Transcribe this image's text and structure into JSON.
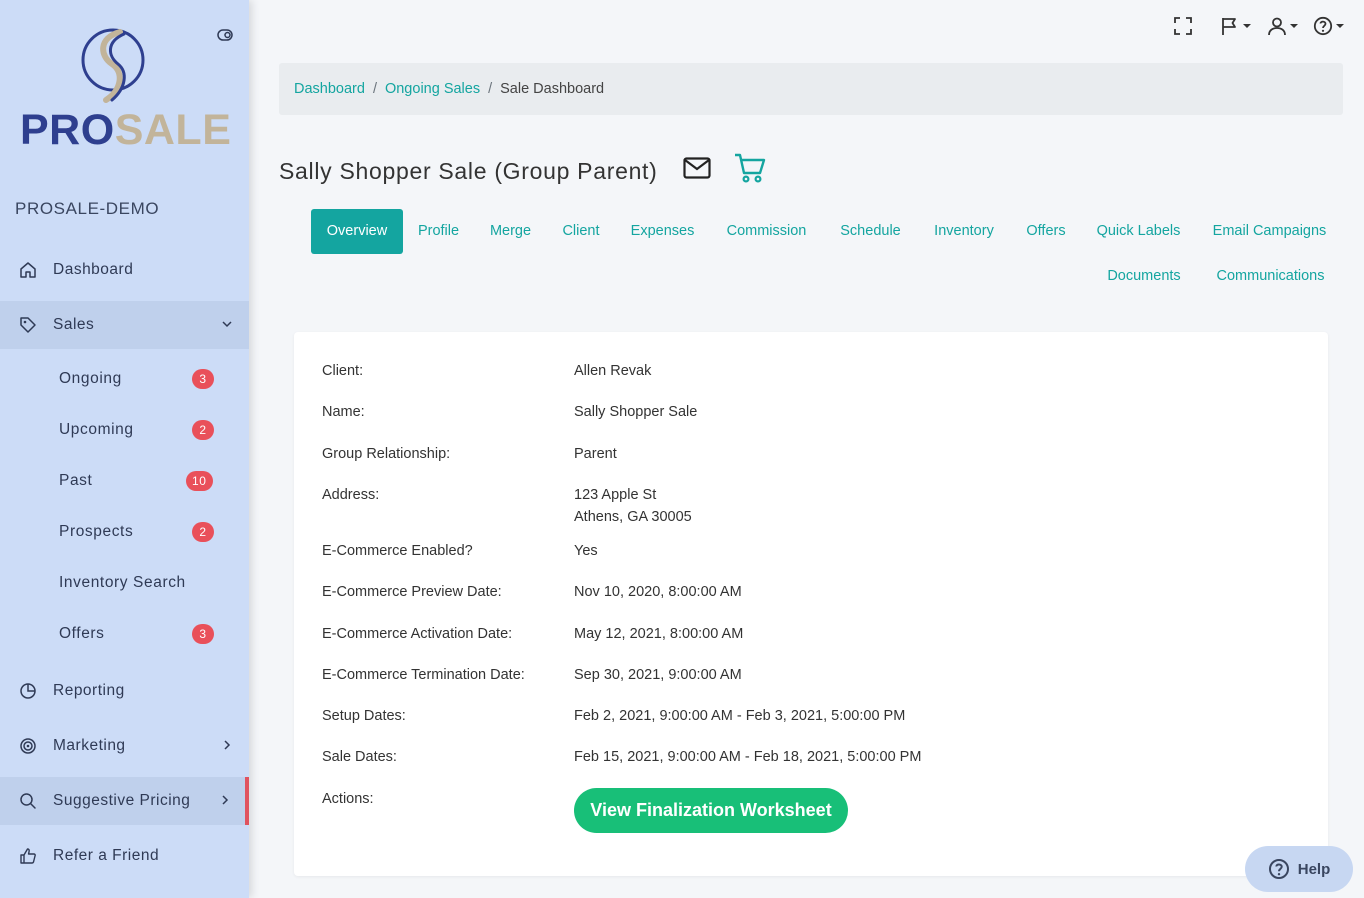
{
  "brand": {
    "word_pro": "PRO",
    "word_sale": "SALE",
    "org_name": "PROSALE-DEMO"
  },
  "sidebar": {
    "items": [
      {
        "label": "Dashboard",
        "icon": "home-icon"
      },
      {
        "label": "Sales",
        "icon": "tag-icon"
      },
      {
        "label": "Reporting",
        "icon": "pie-chart-icon"
      },
      {
        "label": "Marketing",
        "icon": "target-icon"
      },
      {
        "label": "Suggestive Pricing",
        "icon": "search-icon"
      },
      {
        "label": "Refer a Friend",
        "icon": "thumbs-up-icon"
      }
    ],
    "sales_sub": [
      {
        "label": "Ongoing",
        "badge": "3"
      },
      {
        "label": "Upcoming",
        "badge": "2"
      },
      {
        "label": "Past",
        "badge": "10"
      },
      {
        "label": "Prospects",
        "badge": "2"
      },
      {
        "label": "Inventory Search",
        "badge": ""
      },
      {
        "label": "Offers",
        "badge": "3"
      }
    ]
  },
  "breadcrumb": {
    "items": [
      "Dashboard",
      "Ongoing Sales"
    ],
    "current": "Sale Dashboard"
  },
  "page": {
    "title": "Sally Shopper Sale (Group Parent)"
  },
  "tabs": [
    "Overview",
    "Profile",
    "Merge",
    "Client",
    "Expenses",
    "Commission",
    "Schedule",
    "Inventory",
    "Offers",
    "Quick Labels",
    "Email Campaigns",
    "Documents",
    "Communications"
  ],
  "details": [
    {
      "label": "Client:",
      "value": "Allen Revak"
    },
    {
      "label": "Name:",
      "value": "Sally Shopper Sale"
    },
    {
      "label": "Group Relationship:",
      "value": "Parent"
    },
    {
      "label": "Address:",
      "value": "123 Apple St",
      "value2": "Athens, GA 30005"
    },
    {
      "label": "E-Commerce Enabled?",
      "value": "Yes"
    },
    {
      "label": "E-Commerce Preview Date:",
      "value": "Nov 10, 2020, 8:00:00 AM"
    },
    {
      "label": "E-Commerce Activation Date:",
      "value": "May 12, 2021, 8:00:00 AM"
    },
    {
      "label": "E-Commerce Termination Date:",
      "value": "Sep 30, 2021, 9:00:00 AM"
    },
    {
      "label": "Setup Dates:",
      "value": "Feb 2, 2021, 9:00:00 AM - Feb 3, 2021, 5:00:00 PM"
    },
    {
      "label": "Sale Dates:",
      "value": "Feb 15, 2021, 9:00:00 AM - Feb 18, 2021, 5:00:00 PM"
    },
    {
      "label": "Actions:",
      "value": ""
    }
  ],
  "actions": {
    "finalize_label": "View Finalization Worksheet"
  },
  "help": {
    "label": "Help"
  },
  "colors": {
    "accent": "#14a5a0",
    "cta": "#18bf78",
    "badge": "#e9505a",
    "sidebar": "#ccdcf7"
  }
}
